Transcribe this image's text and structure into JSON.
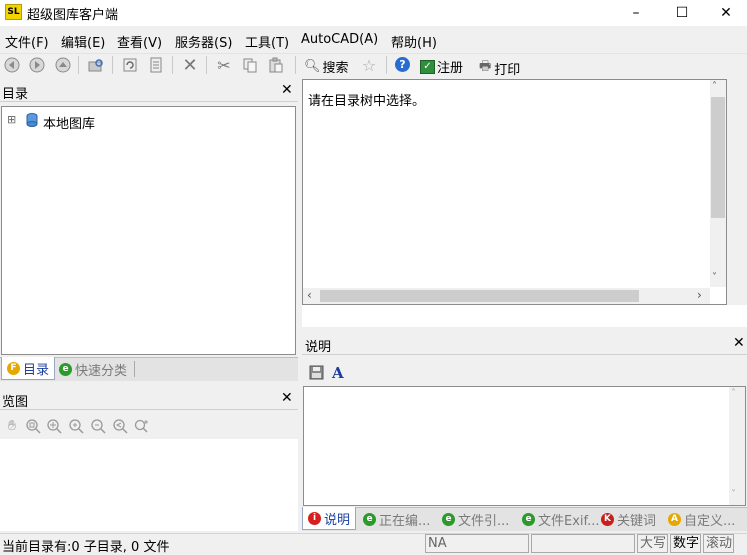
{
  "window": {
    "title": "超级图库客户端",
    "app_icon_text": "SL",
    "minimize": "–",
    "maximize": "☐",
    "close": "✕"
  },
  "menu": [
    {
      "label": "文件(F)"
    },
    {
      "label": "编辑(E)"
    },
    {
      "label": "查看(V)"
    },
    {
      "label": "服务器(S)"
    },
    {
      "label": "工具(T)"
    },
    {
      "label": "AutoCAD(A)"
    },
    {
      "label": "帮助(H)"
    }
  ],
  "toolbar": {
    "search_label": "搜索",
    "register_label": "注册",
    "print_label": "打印"
  },
  "catalog": {
    "title": "目录",
    "tree_root": "本地图库",
    "expander": "⊞"
  },
  "preview": {
    "message": "请在目录树中选择。"
  },
  "left_tabs": [
    {
      "label": "目录",
      "icon": "catalog-icon",
      "color": "#e6a800"
    },
    {
      "label": "快速分类",
      "icon": "quick-category-icon",
      "color": "#2a9a2a"
    }
  ],
  "overview": {
    "title": "览图"
  },
  "description": {
    "title": "说明"
  },
  "bottom_tabs": [
    {
      "label": "说明",
      "icon": "info-icon",
      "letter": "i",
      "color": "#d42020"
    },
    {
      "label": "正在编...",
      "icon": "editing-icon",
      "letter": "e",
      "color": "#2a9a2a"
    },
    {
      "label": "文件引...",
      "icon": "file-ref-icon",
      "letter": "e",
      "color": "#2a9a2a"
    },
    {
      "label": "文件Exif...",
      "icon": "exif-icon",
      "letter": "e",
      "color": "#2a9a2a"
    },
    {
      "label": "关键词",
      "icon": "keyword-icon",
      "letter": "K",
      "color": "#c81e1e"
    },
    {
      "label": "自定义...",
      "icon": "custom-icon",
      "letter": "A",
      "color": "#e6a800"
    }
  ],
  "status": {
    "text": "当前目录有:0 子目录, 0 文件",
    "na": "NA",
    "caps": "大写",
    "num": "数字",
    "scroll": "滚动"
  }
}
